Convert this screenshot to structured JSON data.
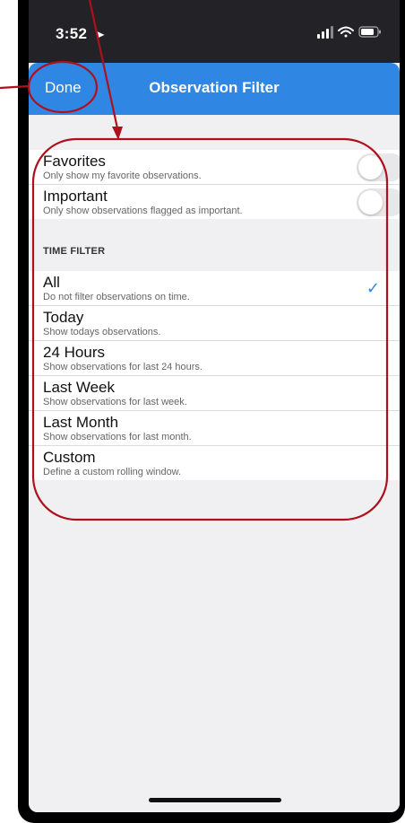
{
  "status_bar": {
    "time": "3:52",
    "location_icon": "location-arrow-icon",
    "signal_icon": "signal-bars-icon",
    "wifi_icon": "wifi-icon",
    "battery_icon": "battery-icon"
  },
  "navbar": {
    "done_label": "Done",
    "title": "Observation Filter",
    "color": "#2f86e3"
  },
  "toggles": [
    {
      "title": "Favorites",
      "subtitle": "Only show my favorite observations.",
      "on": false
    },
    {
      "title": "Important",
      "subtitle": "Only show observations flagged as important.",
      "on": false
    }
  ],
  "time_filter": {
    "header": "TIME FILTER",
    "selected_index": 0,
    "options": [
      {
        "title": "All",
        "subtitle": "Do not filter observations on time."
      },
      {
        "title": "Today",
        "subtitle": "Show todays observations."
      },
      {
        "title": "24 Hours",
        "subtitle": "Show observations for last 24 hours."
      },
      {
        "title": "Last Week",
        "subtitle": "Show observations for last week."
      },
      {
        "title": "Last Month",
        "subtitle": "Show observations for last month."
      },
      {
        "title": "Custom",
        "subtitle": "Define a custom rolling window."
      }
    ]
  },
  "annotation_color": "#b0101c"
}
